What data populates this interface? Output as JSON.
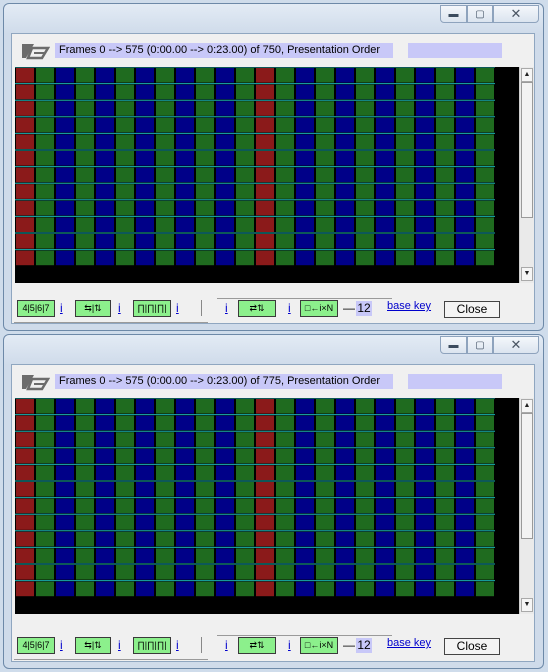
{
  "windows": [
    {
      "id": "top",
      "header": "Frames 0 --> 575 (0:00.00 --> 0:23.00) of 750,  Presentation Order",
      "toolbar": {
        "btn1": "4|5|6|7",
        "btn2": "⇆|⇅",
        "btn3": "∏|∏|∏|",
        "btn4": "⇄⇅",
        "btn5": "□←i×N",
        "i_link": "i",
        "dash": "—",
        "number": "12",
        "base_key": "base key",
        "close": "Close"
      },
      "caption_buttons": {
        "minimize": "▬",
        "maximize": "▢",
        "close": "✕"
      }
    },
    {
      "id": "bottom",
      "header": "Frames 0 --> 575 (0:00.00 --> 0:23.00) of 775,  Presentation Order",
      "toolbar": {
        "btn1": "4|5|6|7",
        "btn2": "⇆|⇅",
        "btn3": "∏|∏|∏|",
        "btn4": "⇄⇅",
        "btn5": "□←i×N",
        "i_link": "i",
        "dash": "—",
        "number": "12",
        "base_key": "base key",
        "close": "Close"
      },
      "caption_buttons": {
        "minimize": "▬",
        "maximize": "▢",
        "close": "✕"
      }
    }
  ],
  "colors": {
    "i_frame": "#8b1a1a",
    "p_frame": "#000088",
    "b_frame": "#1f6b1f",
    "cell_border": "#1ab0b0",
    "grid_bg": "#000000",
    "header_bg": "#c8c8f8",
    "toolbar_button": "#8cf08c",
    "link": "#0000cc"
  },
  "legend": {
    "pattern": "I B P B P B P B P B P B (GOP of 12)"
  }
}
